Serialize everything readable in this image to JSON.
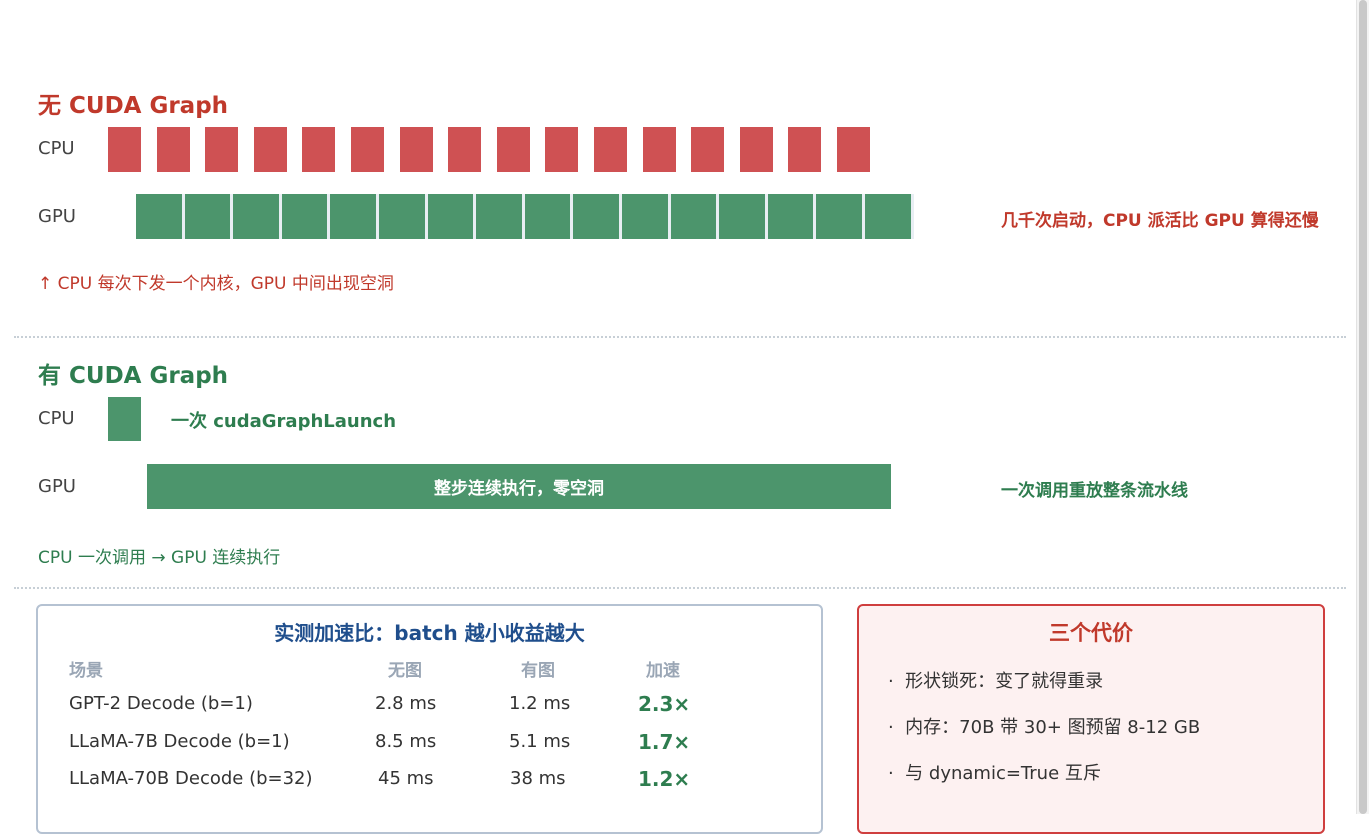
{
  "no_graph": {
    "title": "无 CUDA Graph",
    "cpu_label": "CPU",
    "gpu_label": "GPU",
    "side_note": "几千次启动，CPU 派活比 GPU 算得还慢",
    "caption": "↑ CPU 每次下发一个内核，GPU 中间出现空洞",
    "cpu_launch_count": 16,
    "gpu_kernel_count": 16
  },
  "with_graph": {
    "title": "有 CUDA Graph",
    "cpu_label": "CPU",
    "gpu_label": "GPU",
    "cpu_call_label": "一次 cudaGraphLaunch",
    "gpu_bar_label": "整步连续执行，零空洞",
    "side_note": "一次调用重放整条流水线",
    "caption": "CPU 一次调用 → GPU 连续执行"
  },
  "speedup_table": {
    "title": "实测加速比：batch 越小收益越大",
    "headers": [
      "场景",
      "无图",
      "有图",
      "加速"
    ],
    "rows": [
      [
        "GPT-2 Decode (b=1)",
        "2.8 ms",
        "1.2 ms",
        "2.3×"
      ],
      [
        "LLaMA-7B Decode (b=1)",
        "8.5 ms",
        "5.1 ms",
        "1.7×"
      ],
      [
        "LLaMA-70B Decode (b=32)",
        "45 ms",
        "38 ms",
        "1.2×"
      ]
    ]
  },
  "costs": {
    "title": "三个代价",
    "items": [
      "形状锁死：变了就得重录",
      "内存：70B 带 30+ 图预留 8-12 GB",
      "与 dynamic=True 互斥"
    ]
  },
  "colors": {
    "red": "#cf5153",
    "green": "#4c956c",
    "blue": "#1f4e8c"
  }
}
